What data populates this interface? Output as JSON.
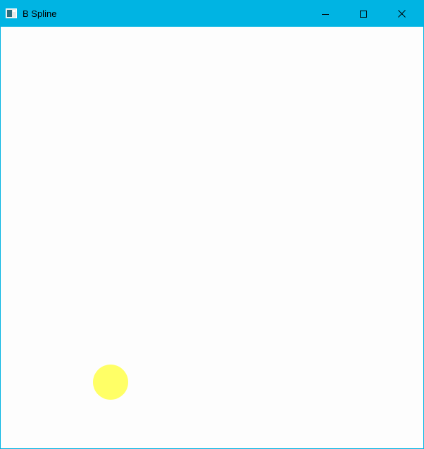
{
  "window": {
    "title": "B Spline",
    "app_icon": "window-app-icon",
    "titlebar_color": "#00b4e3",
    "controls": {
      "minimize_icon": "minimize-icon",
      "maximize_icon": "maximize-icon",
      "close_icon": "close-icon"
    }
  },
  "canvas": {
    "background": "#fdfdfd",
    "control_point": {
      "color": "#ffff66"
    }
  }
}
